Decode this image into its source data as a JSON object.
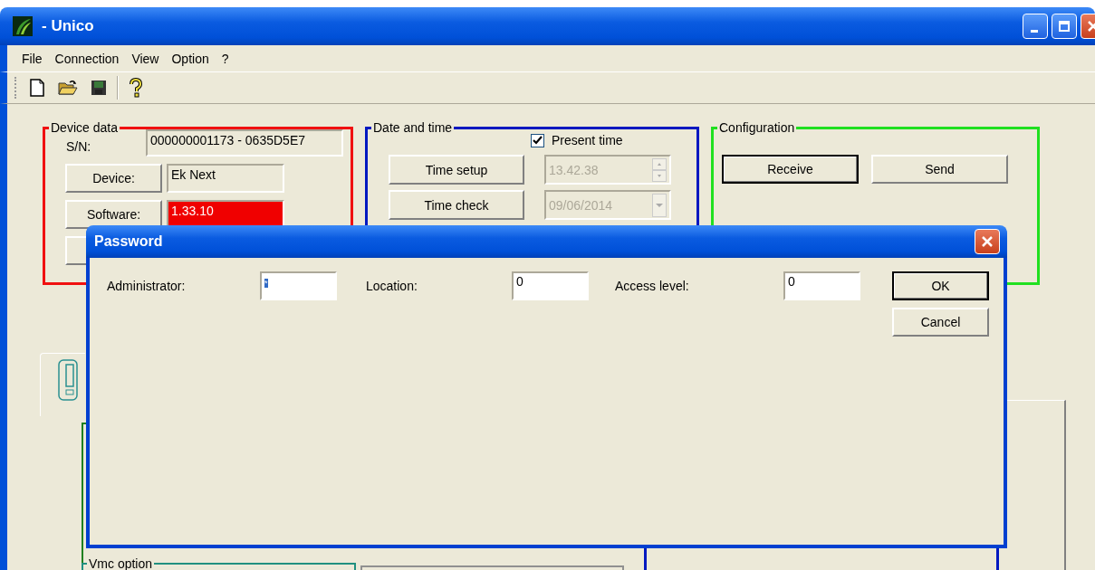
{
  "window": {
    "title": "- Unico"
  },
  "menu": [
    {
      "label": "File"
    },
    {
      "label": "Connection"
    },
    {
      "label": "View"
    },
    {
      "label": "Option"
    },
    {
      "label": "?"
    }
  ],
  "device_data": {
    "title": "Device data",
    "serial_label": "S/N:",
    "serial_value": "000000001173 - 0635D5E7",
    "rows": [
      {
        "button": "Device:",
        "value": "Ek Next",
        "alert": false
      },
      {
        "button": "Software:",
        "value": "1.33.10",
        "alert": true
      }
    ]
  },
  "date_time": {
    "title": "Date and time",
    "present_time": {
      "label": "Present time",
      "checked": true
    },
    "rows": [
      {
        "button": "Time setup",
        "value": "13.42.38",
        "kind": "spin",
        "disabled": true
      },
      {
        "button": "Time check",
        "value": "09/06/2014",
        "kind": "dropdown",
        "disabled": true
      }
    ]
  },
  "configuration": {
    "title": "Configuration",
    "buttons": [
      {
        "label": "Receive",
        "default": true
      },
      {
        "label": "Send",
        "default": false
      }
    ]
  },
  "lower": {
    "group_title": "Vmc option"
  },
  "dialog": {
    "title": "Password",
    "fields": [
      {
        "label": "Administrator:",
        "value": "*",
        "focused": true
      },
      {
        "label": "Location:",
        "value": "0",
        "focused": false
      },
      {
        "label": "Access level:",
        "value": "0",
        "focused": false
      }
    ],
    "buttons": [
      {
        "label": "OK",
        "default": true
      },
      {
        "label": "Cancel",
        "default": false
      }
    ]
  }
}
